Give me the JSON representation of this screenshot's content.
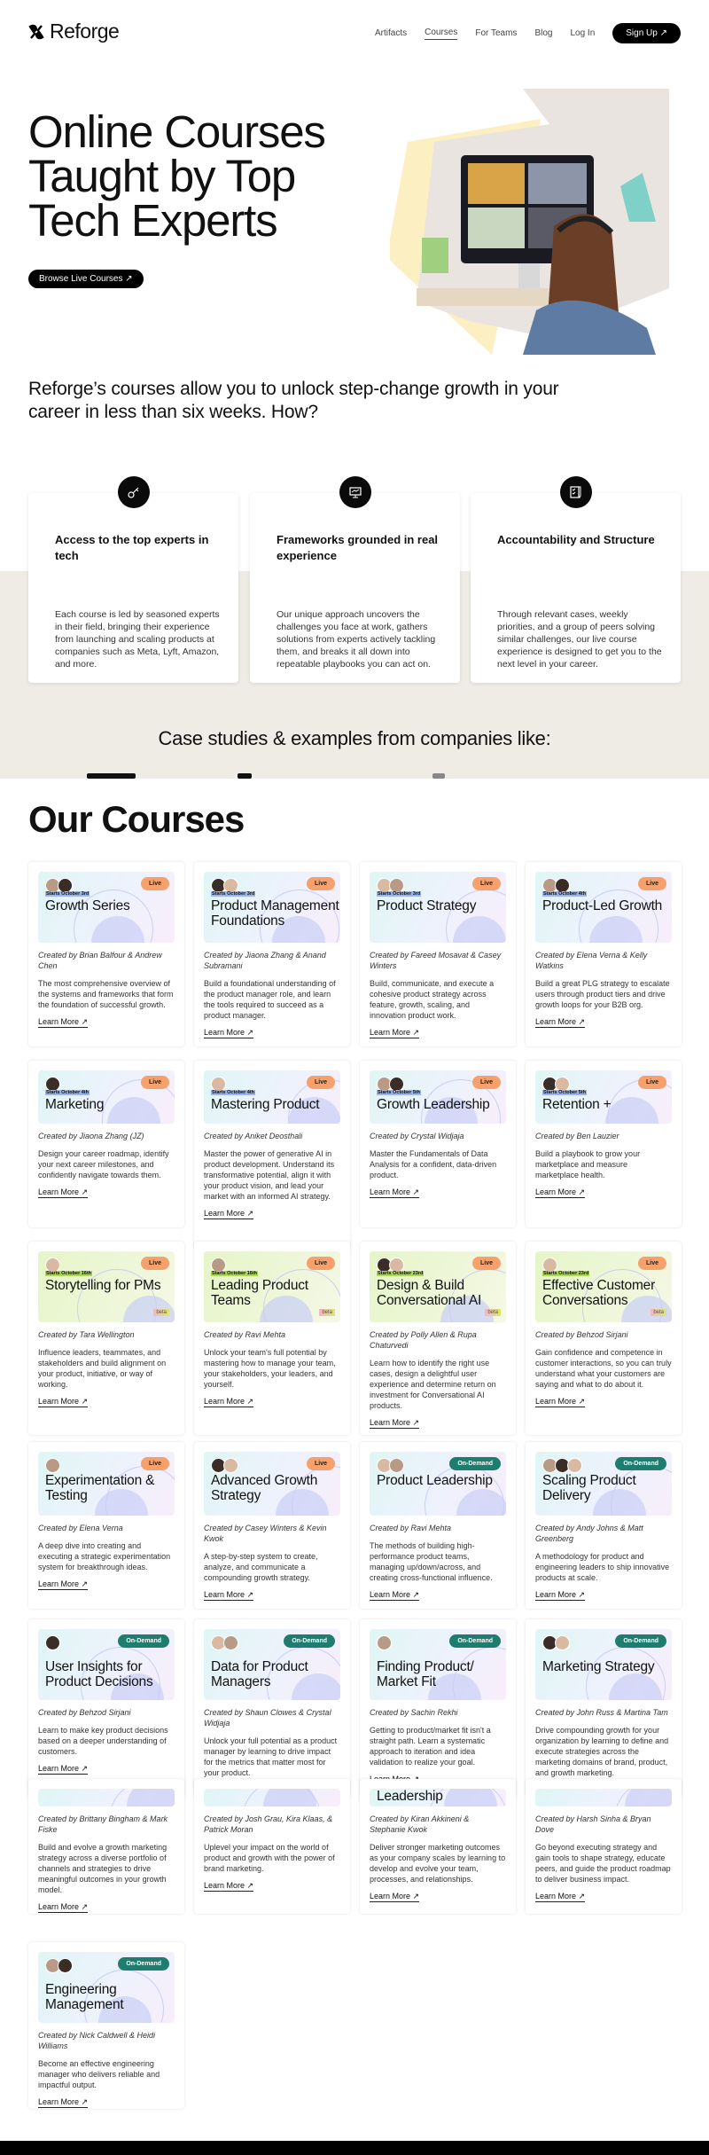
{
  "nav": {
    "brand": "Reforge",
    "links": [
      "Artifacts",
      "Courses",
      "For Teams",
      "Blog",
      "Log In"
    ],
    "active": "Courses",
    "signup": "Sign Up ↗"
  },
  "hero": {
    "title_lines": [
      "Online Courses",
      "Taught by Top",
      "Tech Experts"
    ],
    "cta": "Browse Live Courses ↗",
    "image_alt": "woman-on-video-call-illustration"
  },
  "tagline": "Reforge’s courses allow you to unlock step-change growth in your career in less than six weeks. How?",
  "features": [
    {
      "icon": "key-icon",
      "glyph": "⚷",
      "title": "Access to the top experts in tech",
      "body": "Each course is led by seasoned experts in their field, bringing their experience from launching and scaling products at companies such as Meta, Lyft, Amazon, and more."
    },
    {
      "icon": "monitor-chart-icon",
      "glyph": "▣",
      "title": "Frameworks grounded in real experience",
      "body": "Our unique approach uncovers the challenges you face at work, gathers solutions from experts actively tackling them, and breaks it all down into repeatable playbooks you can act on."
    },
    {
      "icon": "checklist-pencil-icon",
      "glyph": "☑",
      "title": "Accountability and Structure",
      "body": "Through relevant cases, weekly priorities, and a group of peers solving similar challenges, our live course experience is designed to get you to the next level in your career."
    }
  ],
  "cases_heading": "Case studies & examples from companies like:",
  "courses_heading": "Our Courses",
  "learn_more": "Learn More ↗",
  "courses": [
    {
      "title": "Growth Series",
      "badge": "Live",
      "starts": "Starts October 3rd",
      "theme": "blue",
      "beta": false,
      "avatars": 2,
      "by": "Created by Brian Balfour & Andrew Chen",
      "desc": "The most comprehensive overview of the systems and frameworks that form the foundation of successful growth."
    },
    {
      "title": "Product Management Foundations",
      "badge": "Live",
      "starts": "Starts October 3rd",
      "theme": "blue",
      "beta": false,
      "avatars": 2,
      "by": "Created by Jiaona Zhang & Anand Subramani",
      "desc": "Build a foundational understanding of the product manager role, and learn the tools required to succeed as a product manager."
    },
    {
      "title": "Product Strategy",
      "badge": "Live",
      "starts": "Starts October 3rd",
      "theme": "blue",
      "beta": false,
      "avatars": 2,
      "by": "Created by Fareed Mosavat & Casey Winters",
      "desc": "Build, communicate, and execute a cohesive product strategy across feature, growth, scaling, and innovation product work."
    },
    {
      "title": "Product-Led Growth",
      "badge": "Live",
      "starts": "Starts October 4th",
      "theme": "blue",
      "beta": false,
      "avatars": 2,
      "by": "Created by Elena Verna & Kelly Watkins",
      "desc": "Build a great PLG strategy to escalate users through product tiers and drive growth loops for your B2B org."
    },
    {
      "title": "Marketing",
      "badge": "Live",
      "starts": "Starts October 4th",
      "theme": "blue",
      "beta": false,
      "avatars": 1,
      "by": "Created by Jiaona Zhang (JZ)",
      "desc": "Design your career roadmap, identify your next career milestones, and confidently navigate towards them."
    },
    {
      "title": "Mastering Product",
      "badge": "Live",
      "starts": "Starts October 4th",
      "theme": "blue",
      "beta": false,
      "avatars": 1,
      "by": "Created by Aniket Deosthali",
      "desc": "Master the power of generative AI in product development. Understand its transformative potential, align it with your product vision, and lead your market with an informed AI strategy."
    },
    {
      "title": "Growth Leadership",
      "badge": "Live",
      "starts": "Starts October 5th",
      "theme": "blue",
      "beta": false,
      "avatars": 2,
      "by": "Created by Crystal Widjaja",
      "desc": "Master the Fundamentals of Data Analysis for a confident, data-driven product."
    },
    {
      "title": "Retention +",
      "badge": "Live",
      "starts": "Starts October 5th",
      "theme": "blue",
      "beta": false,
      "avatars": 2,
      "by": "Created by Ben Lauzier",
      "desc": "Build a playbook to grow your marketplace and measure marketplace health."
    },
    {
      "title": "Storytelling for PMs",
      "badge": "Live",
      "starts": "Starts October 16th",
      "theme": "green",
      "beta": true,
      "avatars": 1,
      "by": "Created by Tara Wellington",
      "desc": "Influence leaders, teammates, and stakeholders and build alignment on your product, initiative, or way of working."
    },
    {
      "title": "Leading Product Teams",
      "badge": "Live",
      "starts": "Starts October 16th",
      "theme": "green",
      "beta": true,
      "avatars": 1,
      "by": "Created by Ravi Mehta",
      "desc": "Unlock your team's full potential by mastering how to manage your team, your stakeholders, your leaders, and yourself."
    },
    {
      "title": "Design & Build Conversational AI",
      "badge": "Live",
      "starts": "Starts October 23rd",
      "theme": "green",
      "beta": true,
      "avatars": 2,
      "by": "Created by Polly Allen & Rupa Chaturvedi",
      "desc": "Learn how to identify the right use cases, design a delightful user experience and determine return on investment for Conversational AI products."
    },
    {
      "title": "Effective Customer Conversations",
      "badge": "Live",
      "starts": "Starts October 23rd",
      "theme": "green",
      "beta": true,
      "avatars": 1,
      "by": "Created by Behzod Sirjani",
      "desc": "Gain confidence and competence in customer interactions, so you can truly understand what your customers are saying and what to do about it."
    },
    {
      "title": "Experimentation & Testing",
      "badge": "Live",
      "starts": "",
      "theme": "blue",
      "beta": false,
      "avatars": 1,
      "by": "Created by Elena Verna",
      "desc": "A deep dive into creating and executing a strategic experimentation system for breakthrough ideas."
    },
    {
      "title": "Advanced Growth Strategy",
      "badge": "Live",
      "starts": "",
      "theme": "blue",
      "beta": false,
      "avatars": 2,
      "by": "Created by Casey Winters & Kevin Kwok",
      "desc": "A step-by-step system to create, analyze, and communicate a compounding growth strategy."
    },
    {
      "title": "Product Leadership",
      "badge": "On-Demand",
      "starts": "",
      "theme": "blue",
      "beta": false,
      "avatars": 2,
      "by": "Created by Ravi Mehta",
      "desc": "The methods of building high-performance product teams, managing up/down/across, and creating cross-functional influence."
    },
    {
      "title": "Scaling Product Delivery",
      "badge": "On-Demand",
      "starts": "",
      "theme": "blue",
      "beta": false,
      "avatars": 3,
      "by": "Created by Andy Johns & Matt Greenberg",
      "desc": "A methodology for product and engineering leaders to ship innovative products at scale."
    },
    {
      "title": "User Insights for Product Decisions",
      "badge": "On-Demand",
      "starts": "",
      "theme": "blue",
      "beta": false,
      "avatars": 1,
      "by": "Created by Behzod Sirjani",
      "desc": "Learn to make key product decisions based on a deeper understanding of customers."
    },
    {
      "title": "Data for Product Managers",
      "badge": "On-Demand",
      "starts": "",
      "theme": "blue",
      "beta": false,
      "avatars": 2,
      "by": "Created by Shaun Clowes & Crystal Widjaja",
      "desc": "Unlock your full potential as a product manager by learning to drive impact for the metrics that matter most for your product."
    },
    {
      "title": "Finding Product/ Market Fit",
      "badge": "On-Demand",
      "starts": "",
      "theme": "blue",
      "beta": false,
      "avatars": 1,
      "by": "Created by Sachin Rekhi",
      "desc": "Getting to product/market fit isn't a straight path. Learn a systematic approach to iteration and idea validation to realize your goal."
    },
    {
      "title": "Marketing Strategy",
      "badge": "On-Demand",
      "starts": "",
      "theme": "blue",
      "beta": false,
      "avatars": 2,
      "by": "Created by John Russ & Martina Tam",
      "desc": "Drive compounding growth for your organization by learning to define and execute strategies across the marketing domains of brand, product, and growth marketing."
    },
    {
      "title": "",
      "badge": "",
      "starts": "",
      "theme": "blue",
      "beta": false,
      "avatars": 0,
      "by": "Created by Brittany Bingham & Mark Fiske",
      "desc": "Build and evolve a growth marketing strategy across a diverse portfolio of channels and strategies to drive meaningful outcomes in your growth model."
    },
    {
      "title": "",
      "badge": "",
      "starts": "",
      "theme": "blue",
      "beta": false,
      "avatars": 0,
      "by": "Created by Josh Grau, Kira Klaas, & Patrick Moran",
      "desc": "Uplevel your impact on the world of product and growth with the power of brand marketing."
    },
    {
      "title": "Leadership",
      "badge": "",
      "starts": "",
      "theme": "blue",
      "beta": false,
      "avatars": 0,
      "by": "Created by Kiran Akkineni & Stephanie Kwok",
      "desc": "Deliver stronger marketing outcomes as your company scales by learning to develop and evolve your team, processes, and relationships."
    },
    {
      "title": "",
      "badge": "",
      "starts": "",
      "theme": "blue",
      "beta": false,
      "avatars": 0,
      "by": "Created by Harsh Sinha & Bryan Dove",
      "desc": "Go beyond executing strategy and gain tools to shape strategy, educate peers, and guide the product roadmap to deliver business impact."
    },
    {
      "title": "Engineering Management",
      "badge": "On-Demand",
      "starts": "",
      "theme": "blue",
      "beta": false,
      "avatars": 2,
      "by": "Created by Nick Caldwell & Heidi Williams",
      "desc": "Become an effective engineering manager who delivers reliable and impactful output."
    }
  ]
}
